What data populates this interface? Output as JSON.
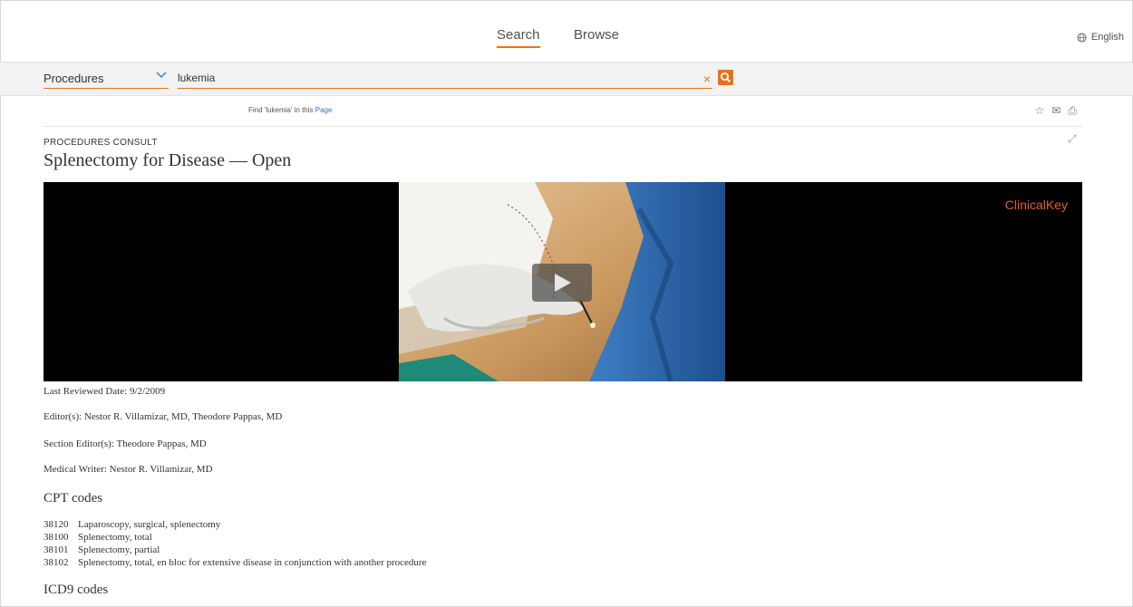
{
  "nav": {
    "tabs": [
      {
        "label": "Search",
        "active": true
      },
      {
        "label": "Browse",
        "active": false
      }
    ],
    "language": "English",
    "language_icon": "globe-icon"
  },
  "search": {
    "scope": "Procedures",
    "query": "lukemia",
    "clear_label": "×",
    "find_prefix": "Find 'lukemia' in this",
    "find_link": "Page"
  },
  "toolbar": {
    "icons": [
      "star-icon",
      "email-icon",
      "print-icon"
    ],
    "star": "☆",
    "email": "✉",
    "print": "⎙",
    "expand": "⤢"
  },
  "article": {
    "kicker": "PROCEDURES CONSULT",
    "title": "Splenectomy for Disease — Open",
    "video_brand": "ClinicalKey",
    "last_reviewed": "Last Reviewed Date: 9/2/2009",
    "editors": "Editor(s): Nestor R. Villamizar, MD, Theodore Pappas, MD",
    "section_editors": "Section Editor(s): Theodore Pappas, MD",
    "medical_writer": "Medical Writer: Nestor R. Villamizar, MD",
    "cpt_heading": "CPT codes",
    "cpt_codes": [
      {
        "code": "38120",
        "desc": "Laparoscopy, surgical, splenectomy"
      },
      {
        "code": "38100",
        "desc": "Splenectomy, total"
      },
      {
        "code": "38101",
        "desc": "Splenectomy, partial"
      },
      {
        "code": "38102",
        "desc": "Splenectomy, total, en bloc for extensive disease in conjunction with another procedure"
      }
    ],
    "icd_heading": "ICD9 codes"
  },
  "colors": {
    "accent": "#e9711c",
    "link": "#3a6fc0",
    "brand": "#d9622b"
  }
}
